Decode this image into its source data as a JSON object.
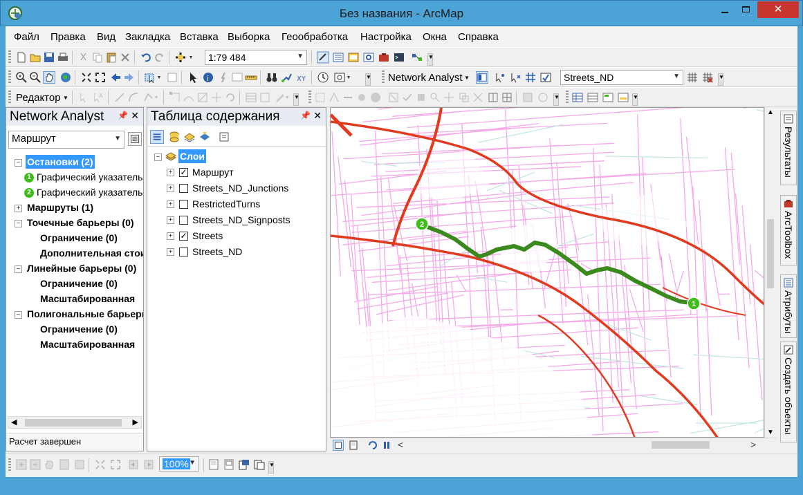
{
  "window": {
    "title": "Без названия - ArcMap",
    "accent": "#4ba3d6",
    "close_color": "#c7352c"
  },
  "menu": {
    "items": [
      "Файл",
      "Правка",
      "Вид",
      "Закладка",
      "Вставка",
      "Выборка",
      "Геообработка",
      "Настройка",
      "Окна",
      "Справка"
    ]
  },
  "toolbar": {
    "scale": "1:79 484",
    "network_analyst_label": "Network Analyst",
    "network_dataset": "Streets_ND",
    "editor_label": "Редактор"
  },
  "na_panel": {
    "title": "Network Analyst",
    "analysis_layer": "Маршрут",
    "tree": {
      "stops": "Остановки (2)",
      "stop1": "Графический указатель",
      "stop2": "Графический указатель",
      "stop1_number": "1",
      "stop2_number": "2",
      "routes": "Маршруты (1)",
      "point_barriers": "Точечные барьеры (0)",
      "pb_restriction": "Ограничение (0)",
      "pb_added_cost": "Дополнительная стоимость",
      "line_barriers": "Линейные барьеры (0)",
      "lb_restriction": "Ограничение (0)",
      "lb_scaled": "Масштабированная",
      "polygon_barriers": "Полигональные барьеры",
      "pgb_restriction": "Ограничение (0)",
      "pgb_scaled": "Масштабированная"
    },
    "status": "Расчет завершен"
  },
  "toc": {
    "title": "Таблица содержания",
    "root": "Слои",
    "layers": [
      {
        "name": "Маршрут",
        "checked": true
      },
      {
        "name": "Streets_ND_Junctions",
        "checked": false
      },
      {
        "name": "RestrictedTurns",
        "checked": false
      },
      {
        "name": "Streets_ND_Signposts",
        "checked": false
      },
      {
        "name": "Streets",
        "checked": true
      },
      {
        "name": "Streets_ND",
        "checked": false
      }
    ]
  },
  "map": {
    "route_color": "#3a8a1e",
    "stop_color": "#3fbd1b",
    "highway_color": "#e03a1f",
    "street_color": "#f5a9e8",
    "minor_color": "#bfe6e0",
    "stop_labels": [
      "1",
      "2"
    ]
  },
  "dock_tabs": [
    "Результаты",
    "ArcToolbox",
    "Атрибуты",
    "Создать объекты"
  ],
  "status_toolbar": {
    "zoom": "100%"
  }
}
